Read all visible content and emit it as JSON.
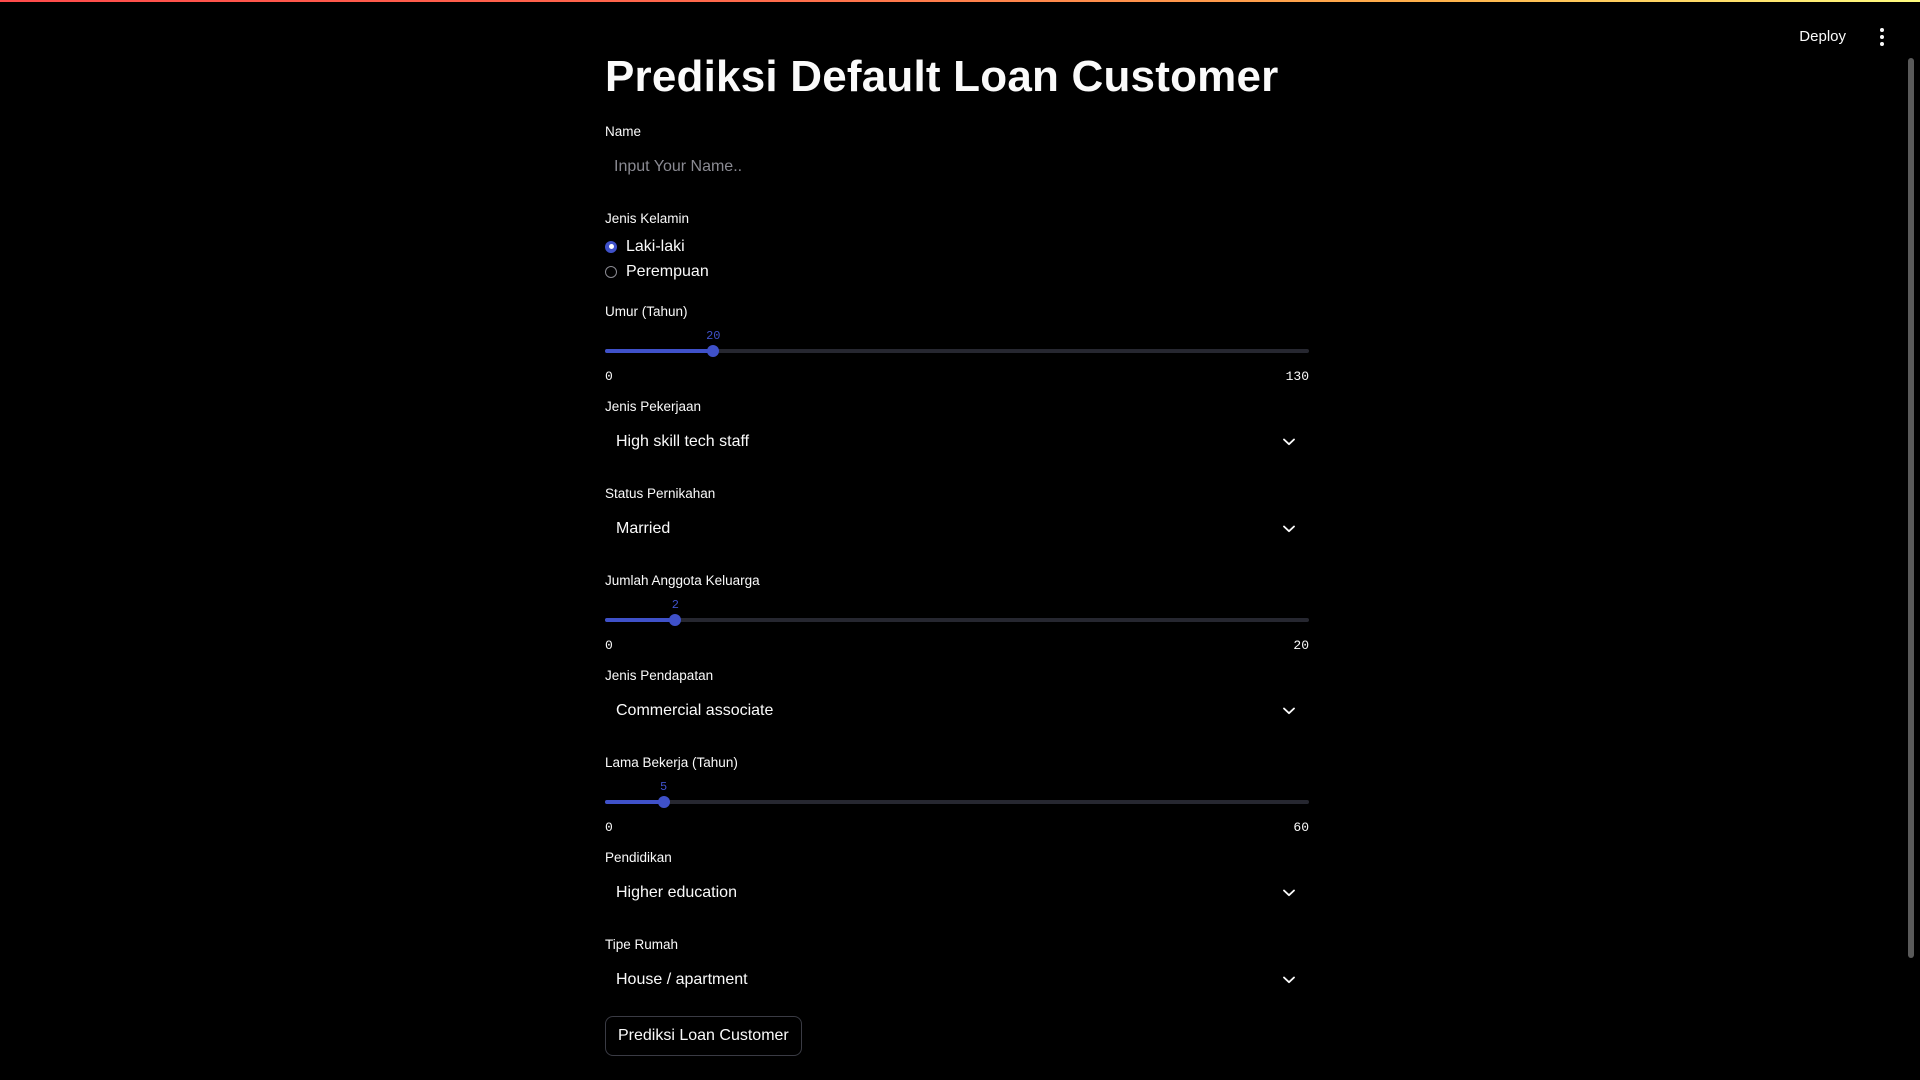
{
  "app": {
    "title": "Prediksi Default Loan Customer"
  },
  "toolbar": {
    "deploy_label": "Deploy",
    "menu_icon": "kebab-menu-icon"
  },
  "form": {
    "name": {
      "label": "Name",
      "value": "",
      "placeholder": "Input Your Name.."
    },
    "gender": {
      "label": "Jenis Kelamin",
      "options": [
        "Laki-laki",
        "Perempuan"
      ],
      "selected": "Laki-laki"
    },
    "age": {
      "label": "Umur (Tahun)",
      "value": 20,
      "min": 0,
      "max": 130
    },
    "job": {
      "label": "Jenis Pekerjaan",
      "selected": "High skill tech staff"
    },
    "marital": {
      "label": "Status Pernikahan",
      "selected": "Married"
    },
    "family": {
      "label": "Jumlah Anggota Keluarga",
      "value": 2,
      "min": 0,
      "max": 20
    },
    "income": {
      "label": "Jenis Pendapatan",
      "selected": "Commercial associate"
    },
    "work_years": {
      "label": "Lama Bekerja (Tahun)",
      "value": 5,
      "min": 0,
      "max": 60
    },
    "education": {
      "label": "Pendidikan",
      "selected": "Higher education"
    },
    "housing": {
      "label": "Tipe Rumah",
      "selected": "House / apartment"
    },
    "submit_label": "Prediksi Loan Customer"
  },
  "colors": {
    "background": "#000000",
    "text": "#fafafa",
    "accent": "#3f51c9",
    "track": "#262730"
  }
}
